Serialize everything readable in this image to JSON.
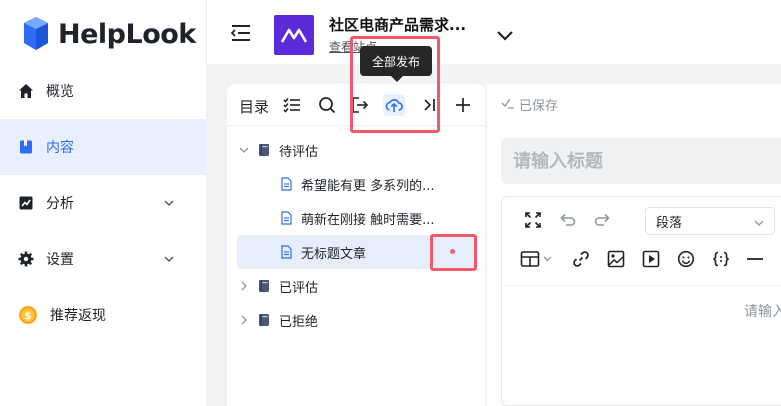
{
  "brand": {
    "name": "HelpLook",
    "color": "#2e6cf6"
  },
  "sidebar": {
    "items": [
      {
        "label": "概览",
        "icon": "home-icon",
        "active": false,
        "has_chevron": false
      },
      {
        "label": "内容",
        "icon": "book-icon",
        "active": true,
        "has_chevron": false
      },
      {
        "label": "分析",
        "icon": "chart-icon",
        "active": false,
        "has_chevron": true
      },
      {
        "label": "设置",
        "icon": "gear-icon",
        "active": false,
        "has_chevron": true
      },
      {
        "label": "推荐返现",
        "icon": "coin-icon",
        "active": false,
        "has_chevron": false
      }
    ]
  },
  "header": {
    "kb_title": "社区电商产品需求...",
    "kb_link": "查看站点",
    "kb_logo_color": "#5b2bd9"
  },
  "tooltip": {
    "text": "全部发布"
  },
  "directory": {
    "title": "目录",
    "tree": [
      {
        "label": "待评估",
        "type": "folder",
        "expanded": true,
        "depth": 0
      },
      {
        "label": "希望能有更 多系列的...",
        "type": "doc",
        "depth": 1
      },
      {
        "label": "萌新在刚接 触时需要...",
        "type": "doc",
        "depth": 1
      },
      {
        "label": "无标题文章",
        "type": "doc",
        "depth": 1,
        "selected": true
      },
      {
        "label": "已评估",
        "type": "folder",
        "expanded": false,
        "depth": 0
      },
      {
        "label": "已拒绝",
        "type": "folder",
        "expanded": false,
        "depth": 0
      }
    ]
  },
  "editor": {
    "saved_status": "已保存",
    "title_placeholder": "请输入标题",
    "paragraph_select": "段落",
    "body_placeholder": "请输入"
  },
  "colors": {
    "accent": "#2e6cf6",
    "highlight": "#f05a6a",
    "selected_bg": "#e7eefb"
  }
}
